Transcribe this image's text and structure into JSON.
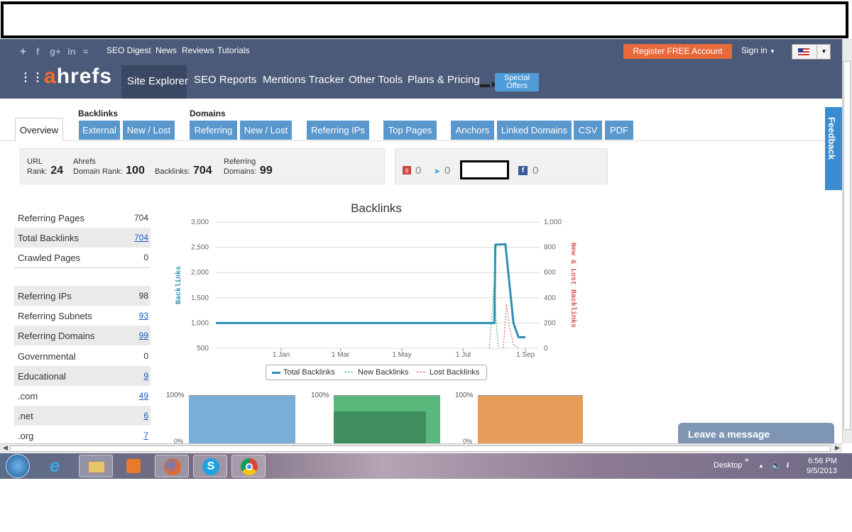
{
  "top_links": [
    "SEO Digest",
    "News",
    "Reviews",
    "Tutorials"
  ],
  "register_label": "Register FREE Account",
  "signin_label": "Sign in",
  "logo": {
    "accent": "a",
    "rest": "hrefs"
  },
  "nav": [
    "Site Explorer",
    "SEO Reports",
    "Mentions Tracker",
    "Other Tools",
    "Plans & Pricing"
  ],
  "special_offers": {
    "line1": "Special",
    "line2": "Offers"
  },
  "groups": {
    "backlinks": "Backlinks",
    "domains": "Domains"
  },
  "tabs": [
    "Overview",
    "External",
    "New / Lost",
    "Referring",
    "New / Lost",
    "Referring IPs",
    "Top Pages",
    "Anchors",
    "Linked Domains",
    "CSV",
    "PDF"
  ],
  "stats": {
    "url_rank_top": "URL",
    "url_rank_label": "Rank:",
    "url_rank": "24",
    "ahrefs_top": "Ahrefs",
    "domain_rank_label": "Domain Rank:",
    "domain_rank": "100",
    "backlinks_label": "Backlinks:",
    "backlinks": "704",
    "refdom_top": "Referring",
    "refdom_label": "Domains:",
    "refdom": "99"
  },
  "social_counts": {
    "gplus": "0",
    "twitter": "0",
    "facebook": "0"
  },
  "left_list_a": [
    {
      "label": "Referring Pages",
      "value": "704"
    },
    {
      "label": "Total Backlinks",
      "value": "704"
    },
    {
      "label": "Crawled Pages",
      "value": "0"
    }
  ],
  "left_list_b": [
    {
      "label": "Referring IPs",
      "value": "98"
    },
    {
      "label": "Referring Subnets",
      "value": "93"
    },
    {
      "label": "Referring Domains",
      "value": "99"
    },
    {
      "label": "Governmental",
      "value": "0"
    },
    {
      "label": "Educational",
      "value": "9"
    },
    {
      "label": ".com",
      "value": "49"
    },
    {
      "label": ".net",
      "value": "6"
    },
    {
      "label": ".org",
      "value": "7"
    }
  ],
  "feedback_label": "Feedback",
  "message_label": "Leave a message",
  "colors": {
    "header": "#4a5a78",
    "tab": "#5a97cc",
    "accent": "#e8693a",
    "total": "#2f8fb3",
    "new": "#3aa66b",
    "lost": "#d9534f"
  },
  "chart_data": {
    "type": "line",
    "title": "Backlinks",
    "ylabel": "Backlinks",
    "y2label": "New & Lost Backlinks",
    "ylim": [
      500,
      3000
    ],
    "y2lim": [
      0,
      1000
    ],
    "yticks": [
      "3,000",
      "2,500",
      "2,000",
      "1,500",
      "1,000",
      "500"
    ],
    "y2ticks": [
      "1,000",
      "800",
      "600",
      "400",
      "200",
      "0"
    ],
    "xticks": [
      "1 Jan",
      "1 Mar",
      "1 May",
      "1 Jul",
      "1 Sep"
    ],
    "legend": [
      "Total Backlinks",
      "New Backlinks",
      "Lost Backlinks"
    ],
    "legend_placement": "bottom",
    "series": [
      {
        "name": "Total Backlinks",
        "x": [
          "2012-10-28",
          "2013-07-27",
          "2013-08-01",
          "2013-08-02",
          "2013-08-10",
          "2013-08-12",
          "2013-08-20",
          "2013-08-25",
          "2013-09-01"
        ],
        "values": [
          1000,
          1000,
          1000,
          2550,
          2560,
          2560,
          1000,
          720,
          720
        ]
      },
      {
        "name": "New Backlinks",
        "x": [
          "2013-07-27",
          "2013-07-29",
          "2013-08-01",
          "2013-08-03",
          "2013-08-05"
        ],
        "values": [
          0,
          200,
          550,
          200,
          0
        ]
      },
      {
        "name": "Lost Backlinks",
        "x": [
          "2013-08-10",
          "2013-08-13",
          "2013-08-16",
          "2013-08-20",
          "2013-08-25"
        ],
        "values": [
          0,
          350,
          180,
          30,
          0
        ]
      }
    ]
  },
  "mini_charts": [
    {
      "label_top": "100%",
      "label_bottom": "0%"
    },
    {
      "label_top": "100%"
    },
    {
      "label_top": "100%",
      "label_bottom": "0%"
    }
  ],
  "taskbar": {
    "desktop": "Desktop",
    "time": "6:56 PM",
    "date": "9/5/2013"
  }
}
